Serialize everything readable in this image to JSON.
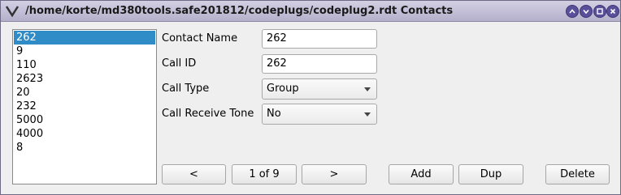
{
  "window": {
    "title": "/home/korte/md380tools.safe201812/codeplugs/codeplug2.rdt Contacts"
  },
  "contacts_list": {
    "items": [
      "262",
      "9",
      "110",
      "2623",
      "20",
      "232",
      "5000",
      "4000",
      "8"
    ],
    "selected_index": 0
  },
  "form": {
    "contact_name_label": "Contact Name",
    "contact_name_value": "262",
    "call_id_label": "Call ID",
    "call_id_value": "262",
    "call_type_label": "Call Type",
    "call_type_value": "Group",
    "call_receive_tone_label": "Call Receive Tone",
    "call_receive_tone_value": "No"
  },
  "nav": {
    "prev_label": "<",
    "page_indicator": "1 of 9",
    "next_label": ">",
    "add_label": "Add",
    "dup_label": "Dup",
    "delete_label": "Delete"
  },
  "colors": {
    "selection": "#308cc6",
    "titlebar_button": "#5a4f9a"
  }
}
